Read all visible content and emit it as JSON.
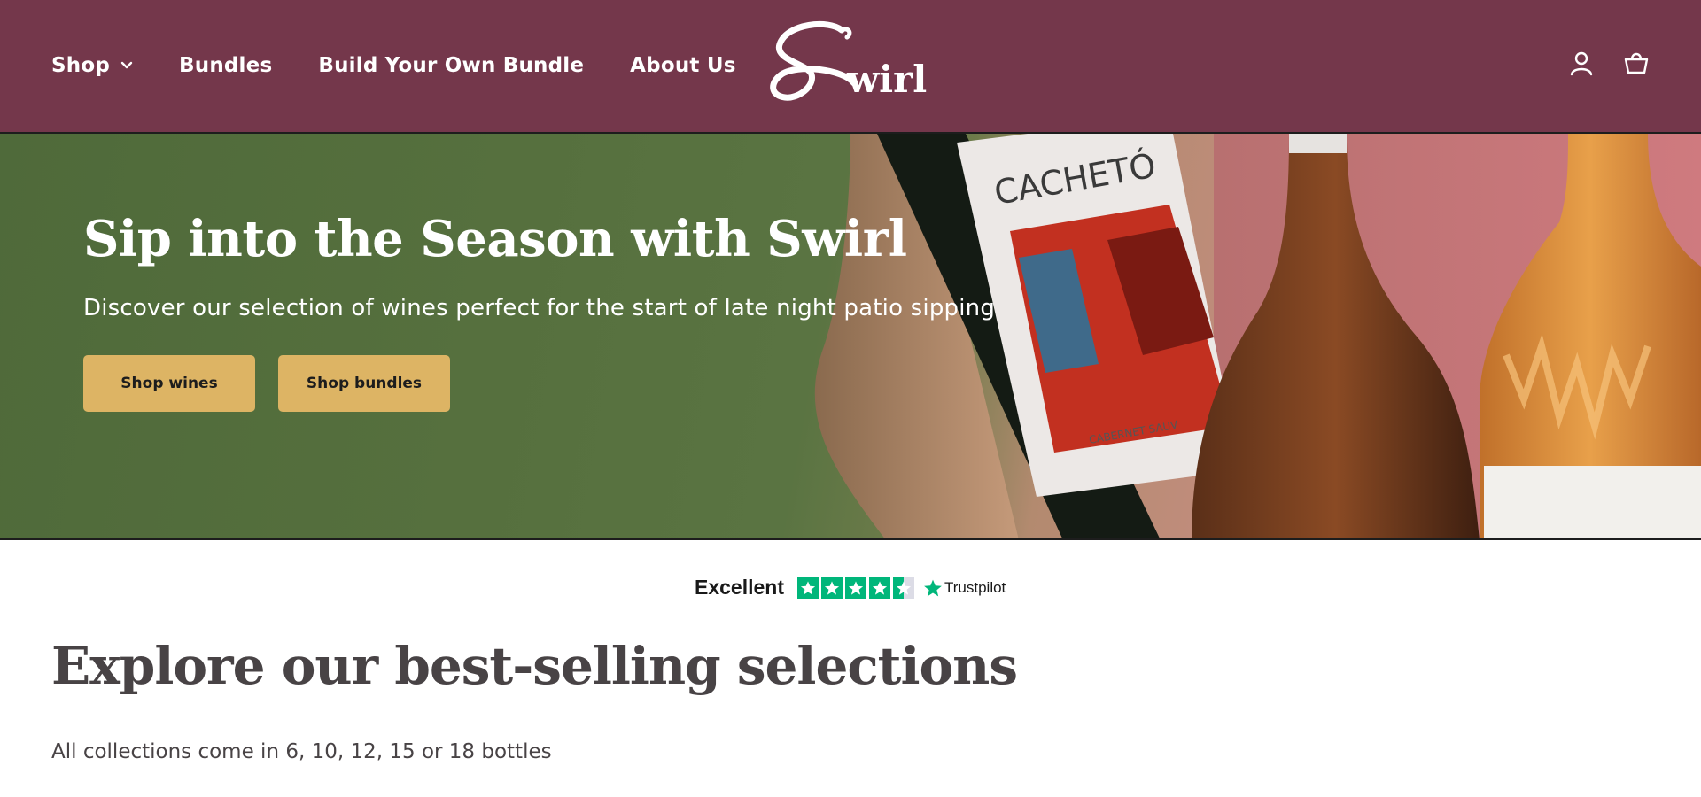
{
  "header": {
    "nav": [
      {
        "label": "Shop"
      },
      {
        "label": "Bundles"
      },
      {
        "label": "Build Your Own Bundle"
      },
      {
        "label": "About Us"
      }
    ],
    "logo_text": "Swirl",
    "icons": [
      "account-icon",
      "cart-icon"
    ]
  },
  "hero": {
    "title": "Sip into the Season with Swirl",
    "subtitle": "Discover our selection of wines perfect for the start of late night patio sipping",
    "buttons": {
      "shop_wines": "Shop wines",
      "shop_bundles": "Shop bundles"
    },
    "bottle_label_brand": "CACHETÓ",
    "bottle_label_varietal": "CABERNET SAUV"
  },
  "trustpilot": {
    "rating_label": "Excellent",
    "stars": 4.5,
    "brand": "Trustpilot"
  },
  "section": {
    "title": "Explore our best-selling selections",
    "subtitle": "All collections come in 6, 10, 12, 15 or 18 bottles"
  },
  "colors": {
    "header_bg": "#74374b",
    "button_bg": "#ddb464",
    "trustpilot_green": "#00b67a",
    "heading_text": "#484345"
  }
}
